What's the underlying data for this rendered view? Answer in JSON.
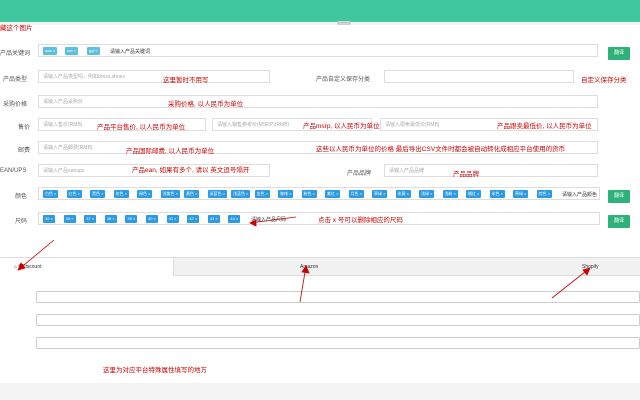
{
  "annotations": {
    "top_left": "藏这个图片",
    "product_type": "这里暂时不用写",
    "custom_category": "自定义保存分类",
    "purchase_price": "采购价格, 以人民币为单位",
    "sale_price": "产品平台售价, 以人民币为单位",
    "msrp": "产品msrp, 以人民币为单位",
    "min_price": "产品跟卖最低价, 以人民币为单位",
    "shipping": "产品国际邮费, 以人民币为单位",
    "currency_note": "这些以人民币为单位的价格 最后导出CSV文件时都会被自动转化成相应平台使用的货币",
    "ean": "产品ean, 如果有多个, 请以 英文逗号隔开",
    "brand": "产品品牌",
    "size_delete": "点击 x 号可以删除相应的尺码",
    "platform_area": "这里为对应平台特殊属性填写的地方"
  },
  "form": {
    "keywords": {
      "label": "产品关键词",
      "tags": [
        "aaa ×",
        "ww ×",
        "ggf ×"
      ],
      "placeholder": "请输入产品关键词",
      "button": "翻译"
    },
    "product_type": {
      "label": "产品类型",
      "placeholder": "请输入产品类型吗，例如dress,shoes"
    },
    "custom_category": {
      "label": "产品自定义保存分类"
    },
    "purchase_price": {
      "label": "采购价格",
      "placeholder": "请输入产品采购价"
    },
    "sale_price": {
      "label": "售价",
      "placeholder": "请输入售价(RMB)"
    },
    "msrp": {
      "placeholder": "请输入销售参考价(MSRP)(RMB)"
    },
    "min_price": {
      "placeholder": "请输入限卖最低价(RMB)"
    },
    "shipping": {
      "label": "邮费",
      "placeholder": "请输入产品邮费(RMB)"
    },
    "ean": {
      "label": "EAN/UPS",
      "placeholder": "请输入产品eanups"
    },
    "brand": {
      "label": "产品品牌",
      "placeholder": "请输入产品品牌"
    },
    "colors": {
      "label": "颜色",
      "tags": [
        "白色 ×",
        "红色 ×",
        "黑色 ×",
        "灰色 ×",
        "绿色 ×",
        "浅紫色 ×",
        "黄色 ×",
        "深蓝色 ×",
        "浅蓝色 ×",
        "金色 ×",
        "咖啡 ×",
        "粉色 ×",
        "紫红 ×",
        "月色 ×",
        "草绿 ×",
        "米黄 ×",
        "浅绿 ×",
        "浅粉 ×",
        "橘红 ×",
        "米色 ×",
        "草绿 ×",
        "棕色 ×"
      ],
      "placeholder": "请输入产品颜色",
      "button": "翻译"
    },
    "sizes": {
      "label": "尺码",
      "tags": [
        "35 ×",
        "36 ×",
        "37 ×",
        "38 ×",
        "39 ×",
        "40 ×",
        "41 ×",
        "42 ×",
        "43 ×",
        "44 ×"
      ],
      "placeholder": "请输入产品尺码",
      "button": "翻译"
    }
  },
  "tabs": [
    {
      "label": "CDiscount",
      "icon": "home-icon"
    },
    {
      "label": "Amazon"
    },
    {
      "label": "Shopify"
    }
  ],
  "colors": {
    "topbar": "#3fc7a0",
    "tag": "#2b9be6",
    "button": "#2db37a",
    "annotation": "#cc0000"
  }
}
